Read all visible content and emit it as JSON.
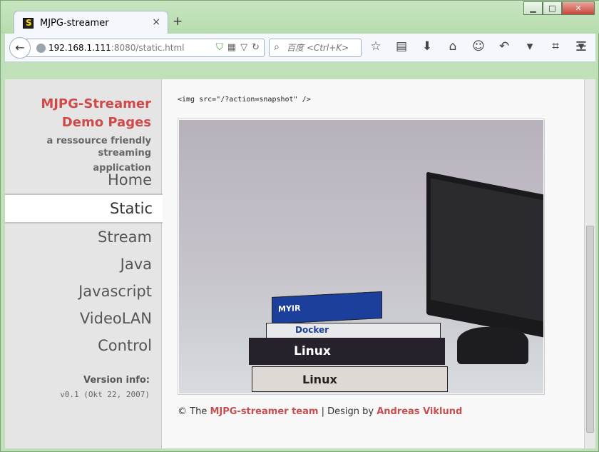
{
  "window": {
    "minimize": "▁",
    "maximize": "□",
    "close": "✕"
  },
  "tab": {
    "title": "MJPG-streamer",
    "close": "×"
  },
  "newtab": "+",
  "urlbar": {
    "host": "192.168.1.111",
    "path": ":8080/static.html"
  },
  "search": {
    "placeholder": "百度 <Ctrl+K>"
  },
  "sidebar": {
    "brand_line1": "MJPG-Streamer",
    "brand_line2": "Demo Pages",
    "tagline_line1": "a ressource friendly streaming",
    "tagline_line2": "application",
    "nav": [
      {
        "label": "Home"
      },
      {
        "label": "Static"
      },
      {
        "label": "Stream"
      },
      {
        "label": "Java"
      },
      {
        "label": "Javascript"
      },
      {
        "label": "VideoLAN"
      },
      {
        "label": "Control"
      }
    ],
    "version_heading": "Version info:",
    "version_value": "v0.1 (Okt 22, 2007)"
  },
  "main": {
    "code": "<img src=\"/?action=snapshot\" />",
    "photo_books": [
      "MYIR",
      "Docker",
      "Linux",
      "Linux"
    ]
  },
  "footer": {
    "copy": "© The ",
    "team": "MJPG-streamer team",
    "sep": " | Design by ",
    "designer": "Andreas Viklund"
  }
}
